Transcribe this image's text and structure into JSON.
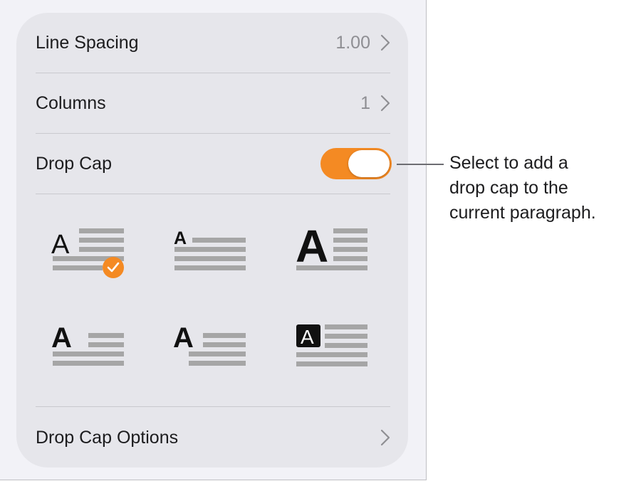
{
  "settings": {
    "line_spacing": {
      "label": "Line Spacing",
      "value": "1.00"
    },
    "columns": {
      "label": "Columns",
      "value": "1"
    },
    "drop_cap": {
      "label": "Drop Cap",
      "enabled": true
    },
    "drop_cap_options": {
      "label": "Drop Cap Options"
    }
  },
  "drop_cap_styles": {
    "glyph": "A",
    "options": [
      {
        "name": "regular-a-three-lines",
        "selected": true
      },
      {
        "name": "small-bold-a-one-line",
        "selected": false
      },
      {
        "name": "large-bold-a-four-lines",
        "selected": false
      },
      {
        "name": "bold-a-two-lines",
        "selected": false
      },
      {
        "name": "bold-a-raised",
        "selected": false
      },
      {
        "name": "boxed-a",
        "selected": false
      }
    ]
  },
  "callout": {
    "lines": [
      "Select to add a",
      "drop cap to the",
      "current paragraph."
    ]
  },
  "colors": {
    "accent": "#f48a23",
    "panel_background": "#f2f2f7",
    "card_background": "#e6e6eb",
    "secondary_text": "#8e8e93",
    "placeholder_lines": "#a6a6a6"
  }
}
